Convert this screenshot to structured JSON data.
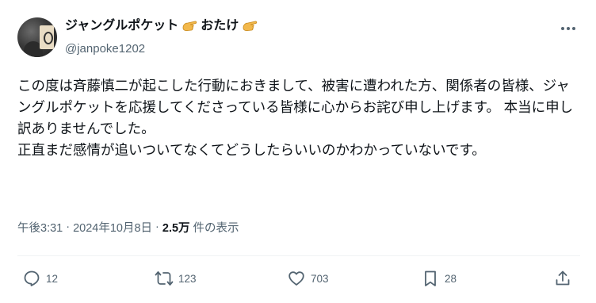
{
  "author": {
    "display_name_part1": "ジャングルポケット",
    "display_name_part2": "おたけ",
    "handle": "@janpoke1202",
    "emoji_icon": "pointing-hand-emoji"
  },
  "tweet": {
    "paragraphs": [
      "この度は斉藤慎二が起こした行動におきまして、被害に遭われた方、関係者の皆様、ジャングルポケットを応援してくださっている皆様に心からお詫び申し上げます。 本当に申し訳ありませんでした。",
      "正直まだ感情が追いついてなくてどうしたらいいのかわかっていないです。"
    ],
    "time": "午後3:31",
    "separator": "·",
    "date": "2024年10月8日",
    "views_count": "2.5万",
    "views_label": "件の表示"
  },
  "actions": {
    "replies": "12",
    "reposts": "123",
    "likes": "703",
    "bookmarks": "28"
  },
  "colors": {
    "text": "#0f1419",
    "secondary": "#536471",
    "divider": "#eff3f4",
    "emoji_skin": "#f2b84b"
  }
}
